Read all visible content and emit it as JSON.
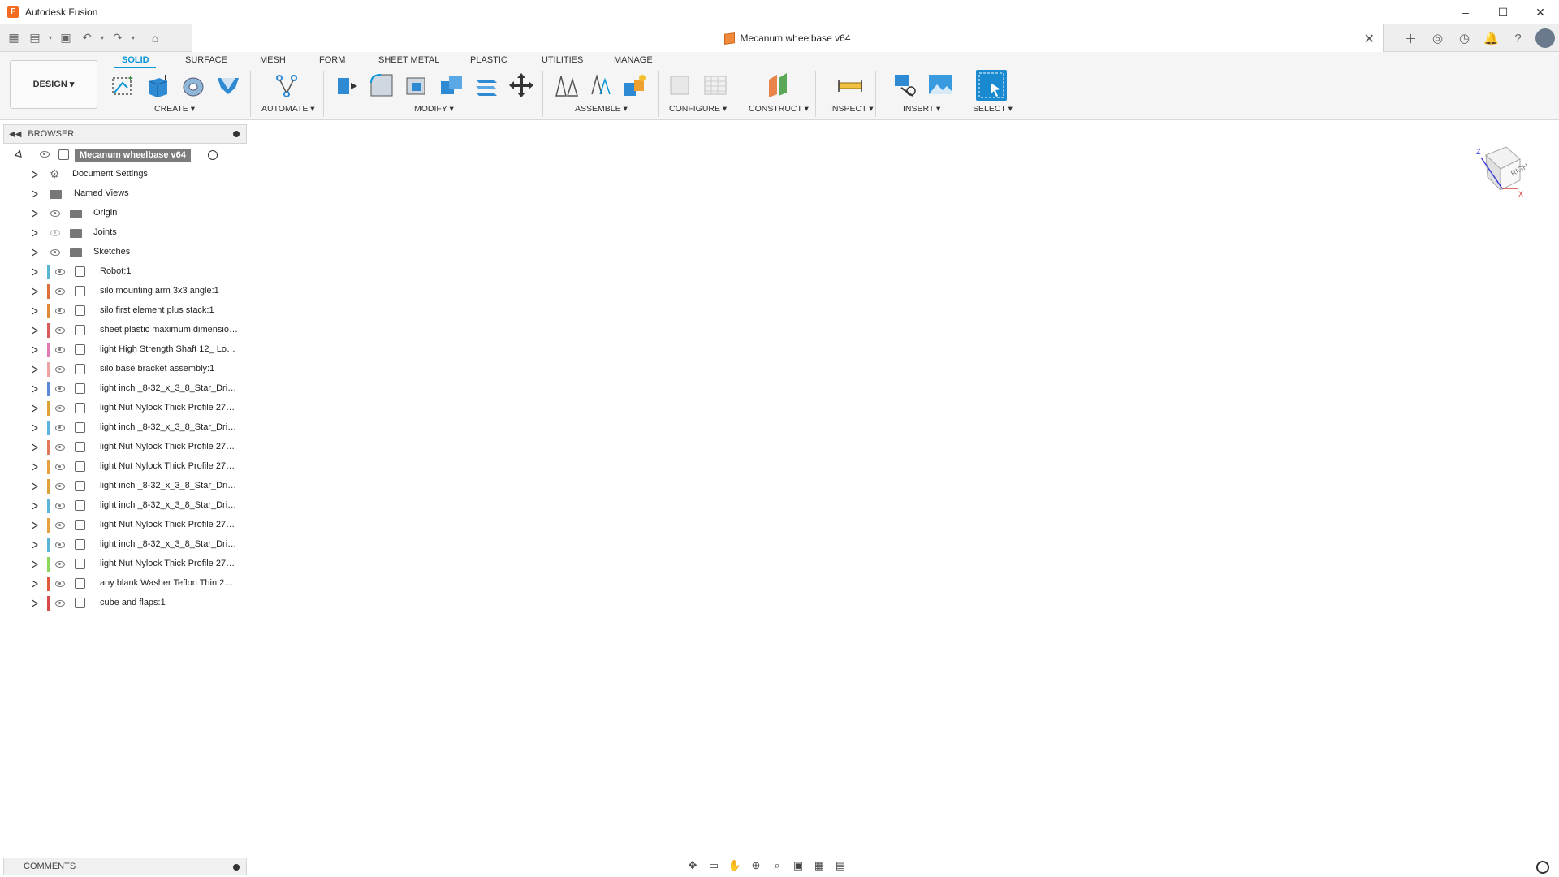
{
  "window": {
    "app_title": "Autodesk Fusion",
    "minimize": "–",
    "maximize": "☐",
    "close": "✕"
  },
  "document": {
    "tab_title": "Mecanum wheelbase v64",
    "tab_close": "✕"
  },
  "ribbon": {
    "workspace": "DESIGN ▾",
    "tabs": [
      "SOLID",
      "SURFACE",
      "MESH",
      "FORM",
      "SHEET METAL",
      "PLASTIC",
      "UTILITIES",
      "MANAGE"
    ],
    "active_tab": "SOLID",
    "groups": [
      "CREATE ▾",
      "AUTOMATE ▾",
      "MODIFY ▾",
      "ASSEMBLE ▾",
      "CONFIGURE ▾",
      "CONSTRUCT ▾",
      "INSPECT ▾",
      "INSERT ▾",
      "SELECT ▾"
    ]
  },
  "browser": {
    "title": "BROWSER",
    "root": "Mecanum wheelbase v64",
    "items": [
      {
        "label": "Document Settings",
        "icon": "gear-icon"
      },
      {
        "label": "Named Views",
        "icon": "folder-icon"
      },
      {
        "label": "Origin",
        "icon": "folder-icon"
      },
      {
        "label": "Joints",
        "icon": "folder-icon"
      },
      {
        "label": "Sketches",
        "icon": "folder-icon"
      },
      {
        "label": "Robot:1",
        "icon": "component-icon",
        "color": "#5bb5d5"
      },
      {
        "label": "silo mounting arm 3x3 angle:1",
        "icon": "component-icon",
        "color": "#e0703a"
      },
      {
        "label": "silo first element plus stack:1",
        "icon": "component-icon",
        "color": "#e08a3a"
      },
      {
        "label": "sheet plastic maximum dimensions...",
        "icon": "component-icon",
        "color": "#d85a5a"
      },
      {
        "label": "light High Strength Shaft 12_ Long...",
        "icon": "component-icon",
        "color": "#e27ab5"
      },
      {
        "label": "silo base bracket assembly:1",
        "icon": "component-icon",
        "color": "#f0a2a2"
      },
      {
        "label": "light inch _8-32_x_3_8_Star_Drive...",
        "icon": "component-icon",
        "color": "#5a8ad8"
      },
      {
        "label": "light Nut Nylock Thick Profile  276-...",
        "icon": "component-icon",
        "color": "#e0a03a"
      },
      {
        "label": "light inch _8-32_x_3_8_Star_Drive...",
        "icon": "component-icon",
        "color": "#5ab5e0"
      },
      {
        "label": "light Nut Nylock Thick Profile  276-...",
        "icon": "component-icon",
        "color": "#e07a5a"
      },
      {
        "label": "light Nut Nylock Thick Profile  276-...",
        "icon": "component-icon",
        "color": "#e8a040"
      },
      {
        "label": "light inch _8-32_x_3_8_Star_Drive...",
        "icon": "component-icon",
        "color": "#e0a03a"
      },
      {
        "label": "light inch _8-32_x_3_8_Star_Drive...",
        "icon": "component-icon",
        "color": "#5ab5d8"
      },
      {
        "label": "light Nut Nylock Thick Profile  276-...",
        "icon": "component-icon",
        "color": "#e8a040"
      },
      {
        "label": "light inch _8-32_x_3_8_Star_Drive...",
        "icon": "component-icon",
        "color": "#5ab5d8"
      },
      {
        "label": "light Nut Nylock Thick Profile  276-...",
        "icon": "component-icon",
        "color": "#8ad85a"
      },
      {
        "label": "any blank Washer Teflon Thin 275...",
        "icon": "component-icon",
        "color": "#e05a3a"
      },
      {
        "label": "cube and flaps:1",
        "icon": "component-icon",
        "color": "#d84a4a"
      }
    ]
  },
  "comments": {
    "title": "COMMENTS"
  },
  "viewcube": {
    "face_label": "RIGHT",
    "axis_z": "Z",
    "axis_x": "X"
  },
  "colors": {
    "accent": "#0696d7",
    "orange_part": "#e8844a",
    "purple_part": "#6a4fc8"
  }
}
